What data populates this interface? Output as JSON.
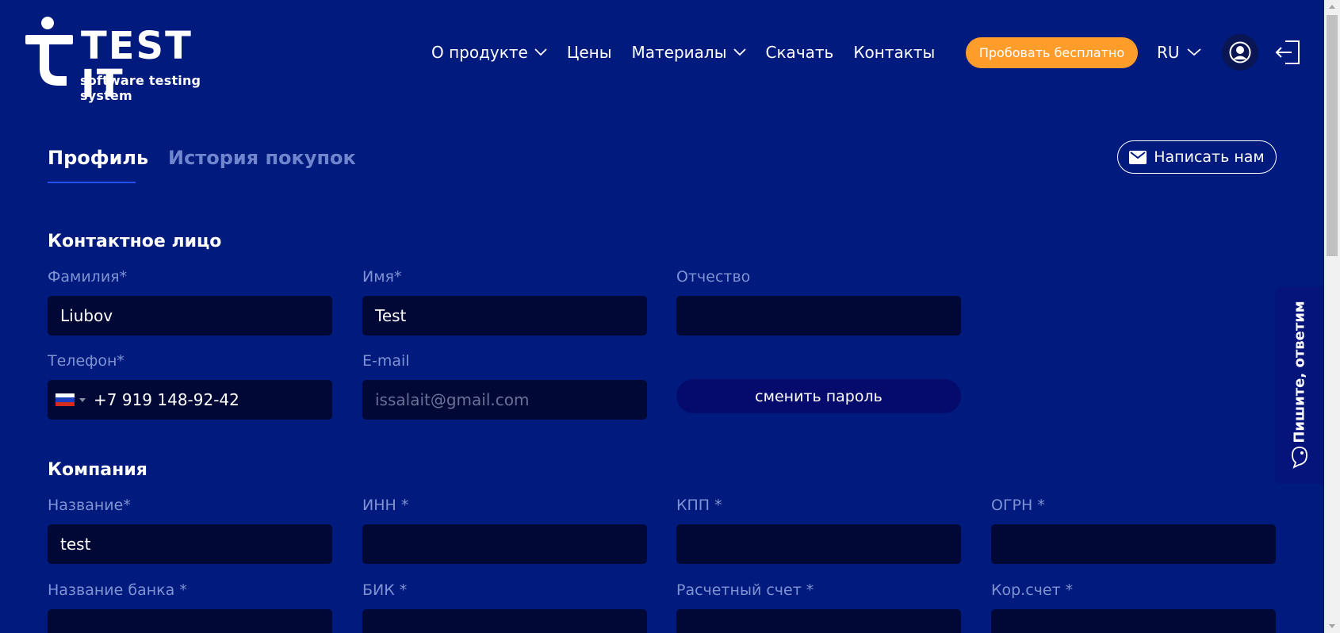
{
  "brand": {
    "title": "TEST IT",
    "subtitle": "software testing system",
    "logo_icon": "test-it-logo-icon"
  },
  "nav": {
    "items": [
      {
        "label": "О продукте",
        "has_dropdown": true
      },
      {
        "label": "Цены",
        "has_dropdown": false
      },
      {
        "label": "Материалы",
        "has_dropdown": true
      },
      {
        "label": "Скачать",
        "has_dropdown": false
      },
      {
        "label": "Контакты",
        "has_dropdown": false
      }
    ],
    "try_button": "Пробовать бесплатно",
    "language": "RU",
    "avatar_icon": "user-icon",
    "logout_icon": "logout-icon"
  },
  "tabs": {
    "profile": "Профиль",
    "history": "История покупок",
    "active": "profile"
  },
  "write_button": {
    "label": "Написать нам",
    "icon": "mail-icon"
  },
  "contact": {
    "title": "Контактное лицо",
    "last_name_label": "Фамилия*",
    "last_name_value": "Liubov",
    "first_name_label": "Имя*",
    "first_name_value": "Test",
    "middle_name_label": "Отчество",
    "middle_name_value": "",
    "phone_label": "Телефон*",
    "phone_value": "+7 919 148-92-42",
    "phone_country_icon": "russia-flag-icon",
    "email_label": "E-mail",
    "email_value": "issalait@gmail.com",
    "change_password": "сменить пароль"
  },
  "company": {
    "title": "Компания",
    "name_label": "Название*",
    "name_value": "test",
    "inn_label": "ИНН *",
    "kpp_label": "КПП *",
    "ogrn_label": "ОГРН *",
    "bank_label": "Название банка *",
    "bik_label": "БИК *",
    "account_label": "Расчетный счет *",
    "corr_label": "Кор.счет *"
  },
  "side_tab": {
    "label": "Пишите, ответим",
    "icon": "chat-icon"
  },
  "colors": {
    "background": "#001a7e",
    "field": "#010835",
    "accent": "#ff9d2b",
    "label": "#7f93d3",
    "tab_underline": "#2450ff"
  }
}
